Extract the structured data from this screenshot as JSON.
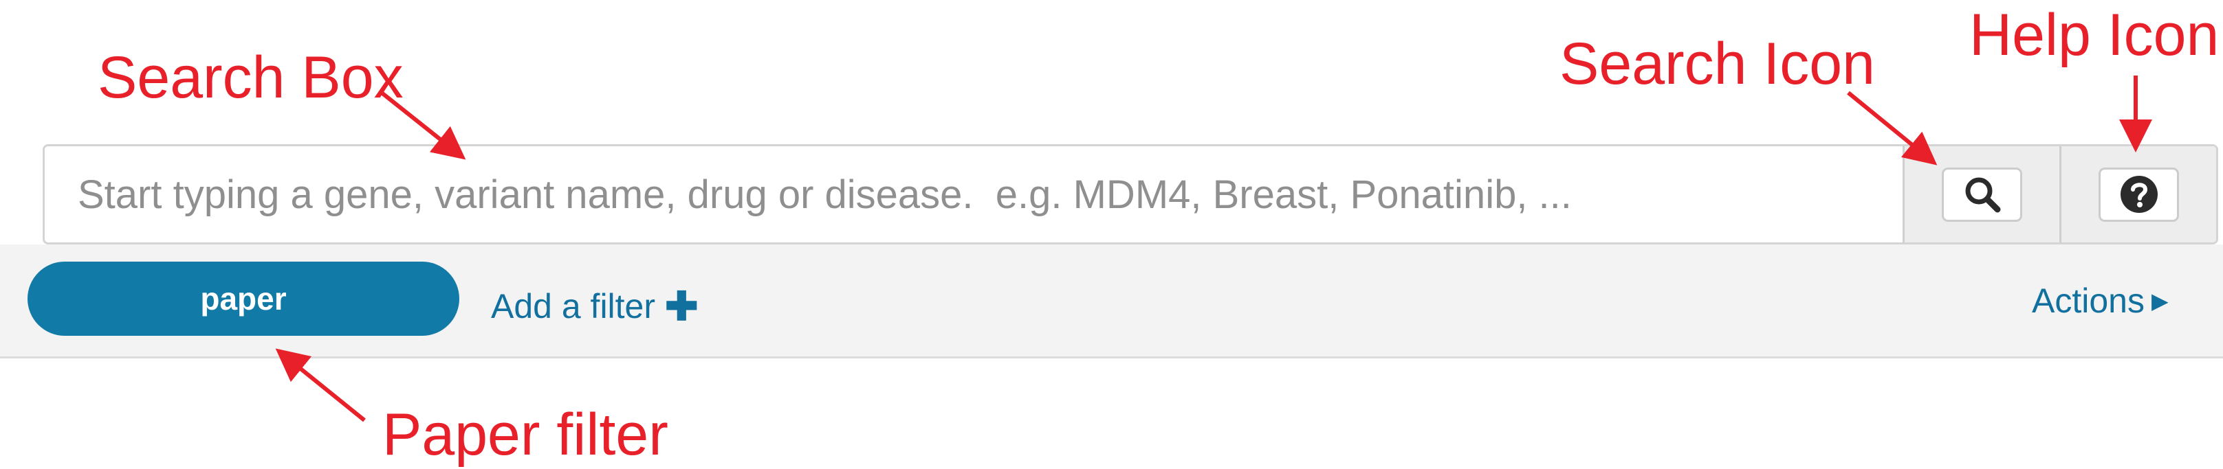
{
  "search": {
    "placeholder": "Start typing a gene, variant name, drug or disease.  e.g. MDM4, Breast, Ponatinib, ...",
    "value": ""
  },
  "icons": {
    "search": "search-icon",
    "help": "help-icon",
    "add": "plus-icon",
    "actions_caret": "caret-right-icon"
  },
  "filters": {
    "active": [
      {
        "label": "paper"
      }
    ],
    "add_label": "Add a filter",
    "plus_glyph": "✚"
  },
  "actions": {
    "label": "Actions",
    "caret_glyph": "▶"
  },
  "annotations": {
    "search_box": "Search Box",
    "search_icon": "Search Icon",
    "help_icon": "Help Icon",
    "paper_filter": "Paper filter"
  },
  "colors": {
    "accent": "#127aa7",
    "link": "#12709e",
    "annotation": "#e8202a",
    "filter_bar_bg": "#f3f3f3"
  }
}
